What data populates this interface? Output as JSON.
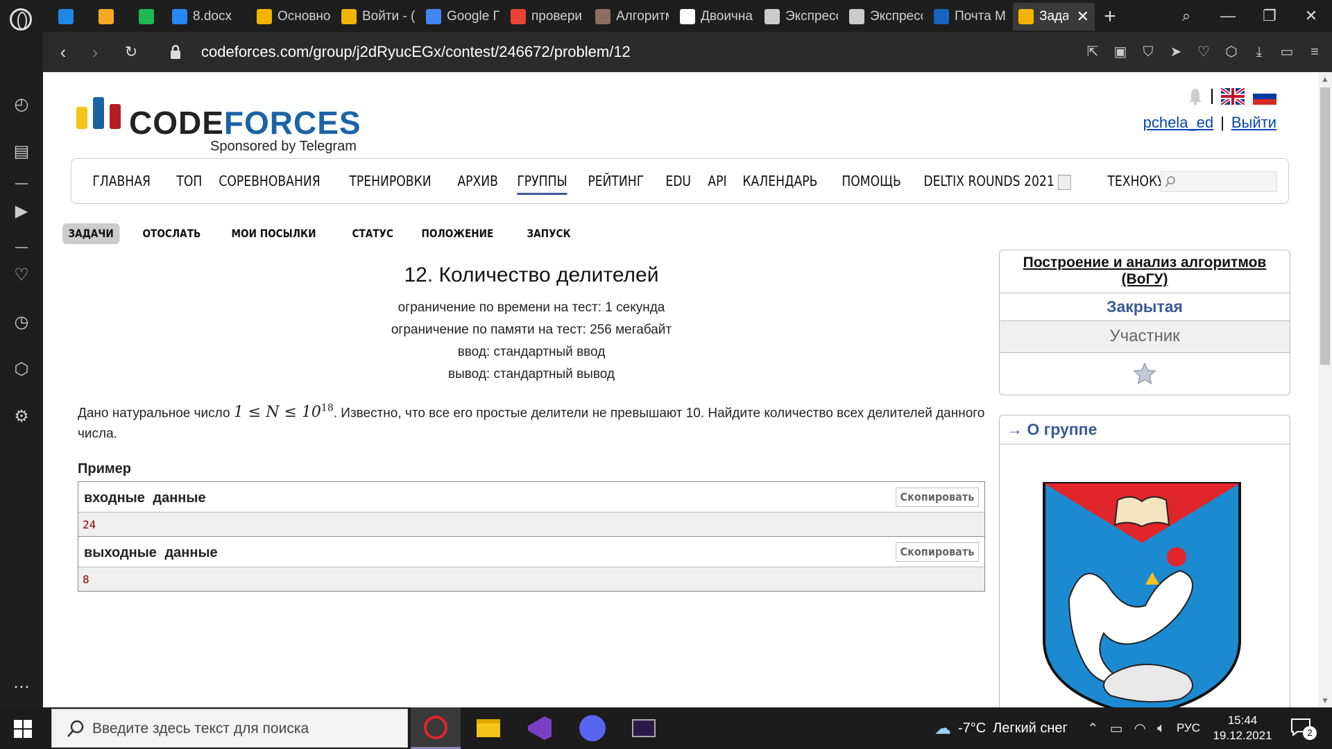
{
  "browser": {
    "tabs": [
      {
        "icon": "chat-icon",
        "title": "",
        "color": "#1e88e5",
        "pinned": true
      },
      {
        "icon": "keep-icon",
        "title": "",
        "color": "#f9a825",
        "pinned": true
      },
      {
        "icon": "spotify-icon",
        "title": "",
        "color": "#1db954",
        "pinned": true
      },
      {
        "icon": "vk-icon",
        "title": "8.docx",
        "color": "#2787f5"
      },
      {
        "icon": "codeforces-icon",
        "title": "Основно",
        "color": "#f0b400"
      },
      {
        "icon": "codeforces-icon",
        "title": "Войти - (",
        "color": "#f0b400"
      },
      {
        "icon": "translate-icon",
        "title": "Google Г",
        "color": "#4285f4"
      },
      {
        "icon": "google-icon",
        "title": "провери",
        "color": "#ea4335"
      },
      {
        "icon": "algo-icon",
        "title": "Алгоритм",
        "color": "#8d6e63"
      },
      {
        "icon": "wikipedia-icon",
        "title": "Двоична",
        "color": "#ffffff"
      },
      {
        "icon": "grid-icon",
        "title": "Экспресс",
        "color": "#cccccc"
      },
      {
        "icon": "grid-icon",
        "title": "Экспресс",
        "color": "#cccccc"
      },
      {
        "icon": "mail-icon",
        "title": "Почта М",
        "color": "#1565c0"
      },
      {
        "icon": "codeforces-icon",
        "title": "Задач",
        "color": "#f0b400",
        "active": true
      }
    ],
    "url": "codeforces.com/group/j2dRyucEGx/contest/246672/problem/12"
  },
  "site": {
    "logo_code": "CODE",
    "logo_forces": "FORCES",
    "logo_sponsor": "Sponsored by Telegram",
    "username": "pchela_ed",
    "logout": "Выйти",
    "user_sep": "|",
    "menu": [
      "ГЛАВНАЯ",
      "ТОП",
      "СОРЕВНОВАНИЯ",
      "ТРЕНИРОВКИ",
      "АРХИВ",
      "ГРУППЫ",
      "РЕЙТИНГ",
      "EDU",
      "API",
      "КАЛЕНДАРЬ",
      "ПОМОЩЬ",
      "DELTIX ROUNDS 2021",
      "ТЕХНОКУБОК"
    ],
    "menu_active": "ГРУППЫ",
    "submenu": [
      "ЗАДАЧИ",
      "ОТОСЛАТЬ",
      "МОИ ПОСЫЛКИ",
      "СТАТУС",
      "ПОЛОЖЕНИЕ",
      "ЗАПУСК"
    ],
    "submenu_active": "ЗАДАЧИ"
  },
  "problem": {
    "title": "12. Количество делителей",
    "time_limit": "ограничение по времени на тест: 1 секунда",
    "memory_limit": "ограничение по памяти на тест: 256 мегабайт",
    "input": "ввод: стандартный ввод",
    "output": "вывод: стандартный вывод",
    "statement_before": "Дано натуральное число ",
    "statement_math": "1 ≤ N ≤ 10",
    "statement_math_exp": "18",
    "statement_after": ". Известно, что все его простые делители не превышают 10. Найдите количество всех делителей данного числа.",
    "example_title": "Пример",
    "input_label": "входные данные",
    "output_label": "выходные данные",
    "copy_label": "Скопировать",
    "example_input": "24",
    "example_output": "8"
  },
  "sidebar": {
    "contest_name": "Построение и анализ алгоритмов (ВоГУ)",
    "contest_type": "Закрытая",
    "role": "Участник",
    "group_link": "→ О группе"
  },
  "taskbar": {
    "search_placeholder": "Введите здесь текст для поиска",
    "temperature": "-7°C",
    "weather": "Легкий снег",
    "lang": "РУС",
    "time": "15:44",
    "date": "19.12.2021",
    "notifications": "2"
  }
}
